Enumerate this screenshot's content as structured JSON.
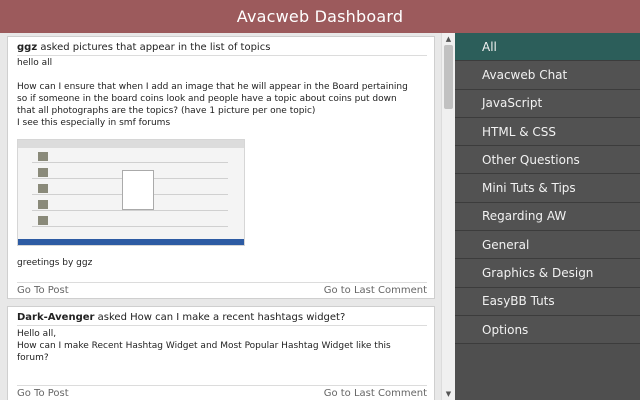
{
  "header": {
    "title": "Avacweb Dashboard"
  },
  "posts": [
    {
      "author": "ggz",
      "action": "asked pictures that appear in the list of topics",
      "body": [
        "hello all",
        "",
        "How can I ensure that when I add an image that he will appear in the Board pertaining",
        "so if someone in the board coins look and people have a topic about coins put down",
        "that all photographs are the topics? (have 1 picture per one topic)",
        "I see this especially in smf forums"
      ],
      "closing": "greetings by ggz",
      "go_to_post": "Go To Post",
      "go_to_last_comment": "Go to Last Comment"
    },
    {
      "author": "Dark-Avenger",
      "action": "asked How can I make a recent hashtags widget?",
      "body": [
        "Hello all,",
        "How can I make Recent Hashtag Widget and Most Popular Hashtag Widget like this",
        "forum?"
      ],
      "go_to_post": "Go To Post",
      "go_to_last_comment": "Go to Last Comment"
    }
  ],
  "sidebar": {
    "items": [
      {
        "label": "All",
        "active": true
      },
      {
        "label": "Avacweb Chat"
      },
      {
        "label": "JavaScript"
      },
      {
        "label": "HTML & CSS"
      },
      {
        "label": "Other Questions"
      },
      {
        "label": "Mini Tuts & Tips"
      },
      {
        "label": "Regarding AW"
      },
      {
        "label": "General"
      },
      {
        "label": "Graphics & Design"
      },
      {
        "label": "EasyBB Tuts"
      },
      {
        "label": "Options"
      }
    ]
  },
  "scrollbar": {
    "up_glyph": "▲",
    "down_glyph": "▼"
  },
  "colors": {
    "header": "#9c5a5c",
    "sidebar": "#525252",
    "active": "#2c5e5a"
  }
}
